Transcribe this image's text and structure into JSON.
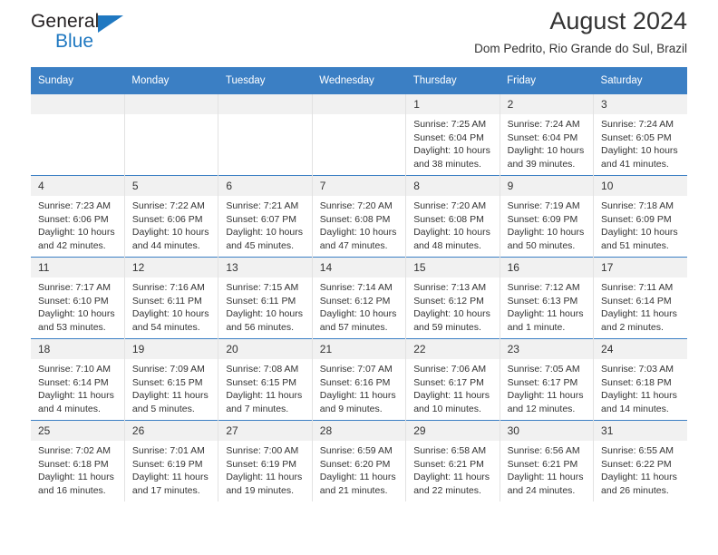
{
  "brand": {
    "word1": "General",
    "word2": "Blue",
    "triangle_color": "#1f78c1"
  },
  "header": {
    "title": "August 2024",
    "subtitle": "Dom Pedrito, Rio Grande do Sul, Brazil"
  },
  "theme": {
    "header_row_bg": "#3b7fc4",
    "header_row_text": "#ffffff",
    "daynum_bg": "#f1f1f1",
    "cell_bg": "#ffffff",
    "text": "#333333"
  },
  "weekday_headers": [
    "Sunday",
    "Monday",
    "Tuesday",
    "Wednesday",
    "Thursday",
    "Friday",
    "Saturday"
  ],
  "weeks": [
    [
      {
        "day": "",
        "lines": []
      },
      {
        "day": "",
        "lines": []
      },
      {
        "day": "",
        "lines": []
      },
      {
        "day": "",
        "lines": []
      },
      {
        "day": "1",
        "lines": [
          "Sunrise: 7:25 AM",
          "Sunset: 6:04 PM",
          "Daylight: 10 hours",
          "and 38 minutes."
        ]
      },
      {
        "day": "2",
        "lines": [
          "Sunrise: 7:24 AM",
          "Sunset: 6:04 PM",
          "Daylight: 10 hours",
          "and 39 minutes."
        ]
      },
      {
        "day": "3",
        "lines": [
          "Sunrise: 7:24 AM",
          "Sunset: 6:05 PM",
          "Daylight: 10 hours",
          "and 41 minutes."
        ]
      }
    ],
    [
      {
        "day": "4",
        "lines": [
          "Sunrise: 7:23 AM",
          "Sunset: 6:06 PM",
          "Daylight: 10 hours",
          "and 42 minutes."
        ]
      },
      {
        "day": "5",
        "lines": [
          "Sunrise: 7:22 AM",
          "Sunset: 6:06 PM",
          "Daylight: 10 hours",
          "and 44 minutes."
        ]
      },
      {
        "day": "6",
        "lines": [
          "Sunrise: 7:21 AM",
          "Sunset: 6:07 PM",
          "Daylight: 10 hours",
          "and 45 minutes."
        ]
      },
      {
        "day": "7",
        "lines": [
          "Sunrise: 7:20 AM",
          "Sunset: 6:08 PM",
          "Daylight: 10 hours",
          "and 47 minutes."
        ]
      },
      {
        "day": "8",
        "lines": [
          "Sunrise: 7:20 AM",
          "Sunset: 6:08 PM",
          "Daylight: 10 hours",
          "and 48 minutes."
        ]
      },
      {
        "day": "9",
        "lines": [
          "Sunrise: 7:19 AM",
          "Sunset: 6:09 PM",
          "Daylight: 10 hours",
          "and 50 minutes."
        ]
      },
      {
        "day": "10",
        "lines": [
          "Sunrise: 7:18 AM",
          "Sunset: 6:09 PM",
          "Daylight: 10 hours",
          "and 51 minutes."
        ]
      }
    ],
    [
      {
        "day": "11",
        "lines": [
          "Sunrise: 7:17 AM",
          "Sunset: 6:10 PM",
          "Daylight: 10 hours",
          "and 53 minutes."
        ]
      },
      {
        "day": "12",
        "lines": [
          "Sunrise: 7:16 AM",
          "Sunset: 6:11 PM",
          "Daylight: 10 hours",
          "and 54 minutes."
        ]
      },
      {
        "day": "13",
        "lines": [
          "Sunrise: 7:15 AM",
          "Sunset: 6:11 PM",
          "Daylight: 10 hours",
          "and 56 minutes."
        ]
      },
      {
        "day": "14",
        "lines": [
          "Sunrise: 7:14 AM",
          "Sunset: 6:12 PM",
          "Daylight: 10 hours",
          "and 57 minutes."
        ]
      },
      {
        "day": "15",
        "lines": [
          "Sunrise: 7:13 AM",
          "Sunset: 6:12 PM",
          "Daylight: 10 hours",
          "and 59 minutes."
        ]
      },
      {
        "day": "16",
        "lines": [
          "Sunrise: 7:12 AM",
          "Sunset: 6:13 PM",
          "Daylight: 11 hours",
          "and 1 minute."
        ]
      },
      {
        "day": "17",
        "lines": [
          "Sunrise: 7:11 AM",
          "Sunset: 6:14 PM",
          "Daylight: 11 hours",
          "and 2 minutes."
        ]
      }
    ],
    [
      {
        "day": "18",
        "lines": [
          "Sunrise: 7:10 AM",
          "Sunset: 6:14 PM",
          "Daylight: 11 hours",
          "and 4 minutes."
        ]
      },
      {
        "day": "19",
        "lines": [
          "Sunrise: 7:09 AM",
          "Sunset: 6:15 PM",
          "Daylight: 11 hours",
          "and 5 minutes."
        ]
      },
      {
        "day": "20",
        "lines": [
          "Sunrise: 7:08 AM",
          "Sunset: 6:15 PM",
          "Daylight: 11 hours",
          "and 7 minutes."
        ]
      },
      {
        "day": "21",
        "lines": [
          "Sunrise: 7:07 AM",
          "Sunset: 6:16 PM",
          "Daylight: 11 hours",
          "and 9 minutes."
        ]
      },
      {
        "day": "22",
        "lines": [
          "Sunrise: 7:06 AM",
          "Sunset: 6:17 PM",
          "Daylight: 11 hours",
          "and 10 minutes."
        ]
      },
      {
        "day": "23",
        "lines": [
          "Sunrise: 7:05 AM",
          "Sunset: 6:17 PM",
          "Daylight: 11 hours",
          "and 12 minutes."
        ]
      },
      {
        "day": "24",
        "lines": [
          "Sunrise: 7:03 AM",
          "Sunset: 6:18 PM",
          "Daylight: 11 hours",
          "and 14 minutes."
        ]
      }
    ],
    [
      {
        "day": "25",
        "lines": [
          "Sunrise: 7:02 AM",
          "Sunset: 6:18 PM",
          "Daylight: 11 hours",
          "and 16 minutes."
        ]
      },
      {
        "day": "26",
        "lines": [
          "Sunrise: 7:01 AM",
          "Sunset: 6:19 PM",
          "Daylight: 11 hours",
          "and 17 minutes."
        ]
      },
      {
        "day": "27",
        "lines": [
          "Sunrise: 7:00 AM",
          "Sunset: 6:19 PM",
          "Daylight: 11 hours",
          "and 19 minutes."
        ]
      },
      {
        "day": "28",
        "lines": [
          "Sunrise: 6:59 AM",
          "Sunset: 6:20 PM",
          "Daylight: 11 hours",
          "and 21 minutes."
        ]
      },
      {
        "day": "29",
        "lines": [
          "Sunrise: 6:58 AM",
          "Sunset: 6:21 PM",
          "Daylight: 11 hours",
          "and 22 minutes."
        ]
      },
      {
        "day": "30",
        "lines": [
          "Sunrise: 6:56 AM",
          "Sunset: 6:21 PM",
          "Daylight: 11 hours",
          "and 24 minutes."
        ]
      },
      {
        "day": "31",
        "lines": [
          "Sunrise: 6:55 AM",
          "Sunset: 6:22 PM",
          "Daylight: 11 hours",
          "and 26 minutes."
        ]
      }
    ]
  ]
}
